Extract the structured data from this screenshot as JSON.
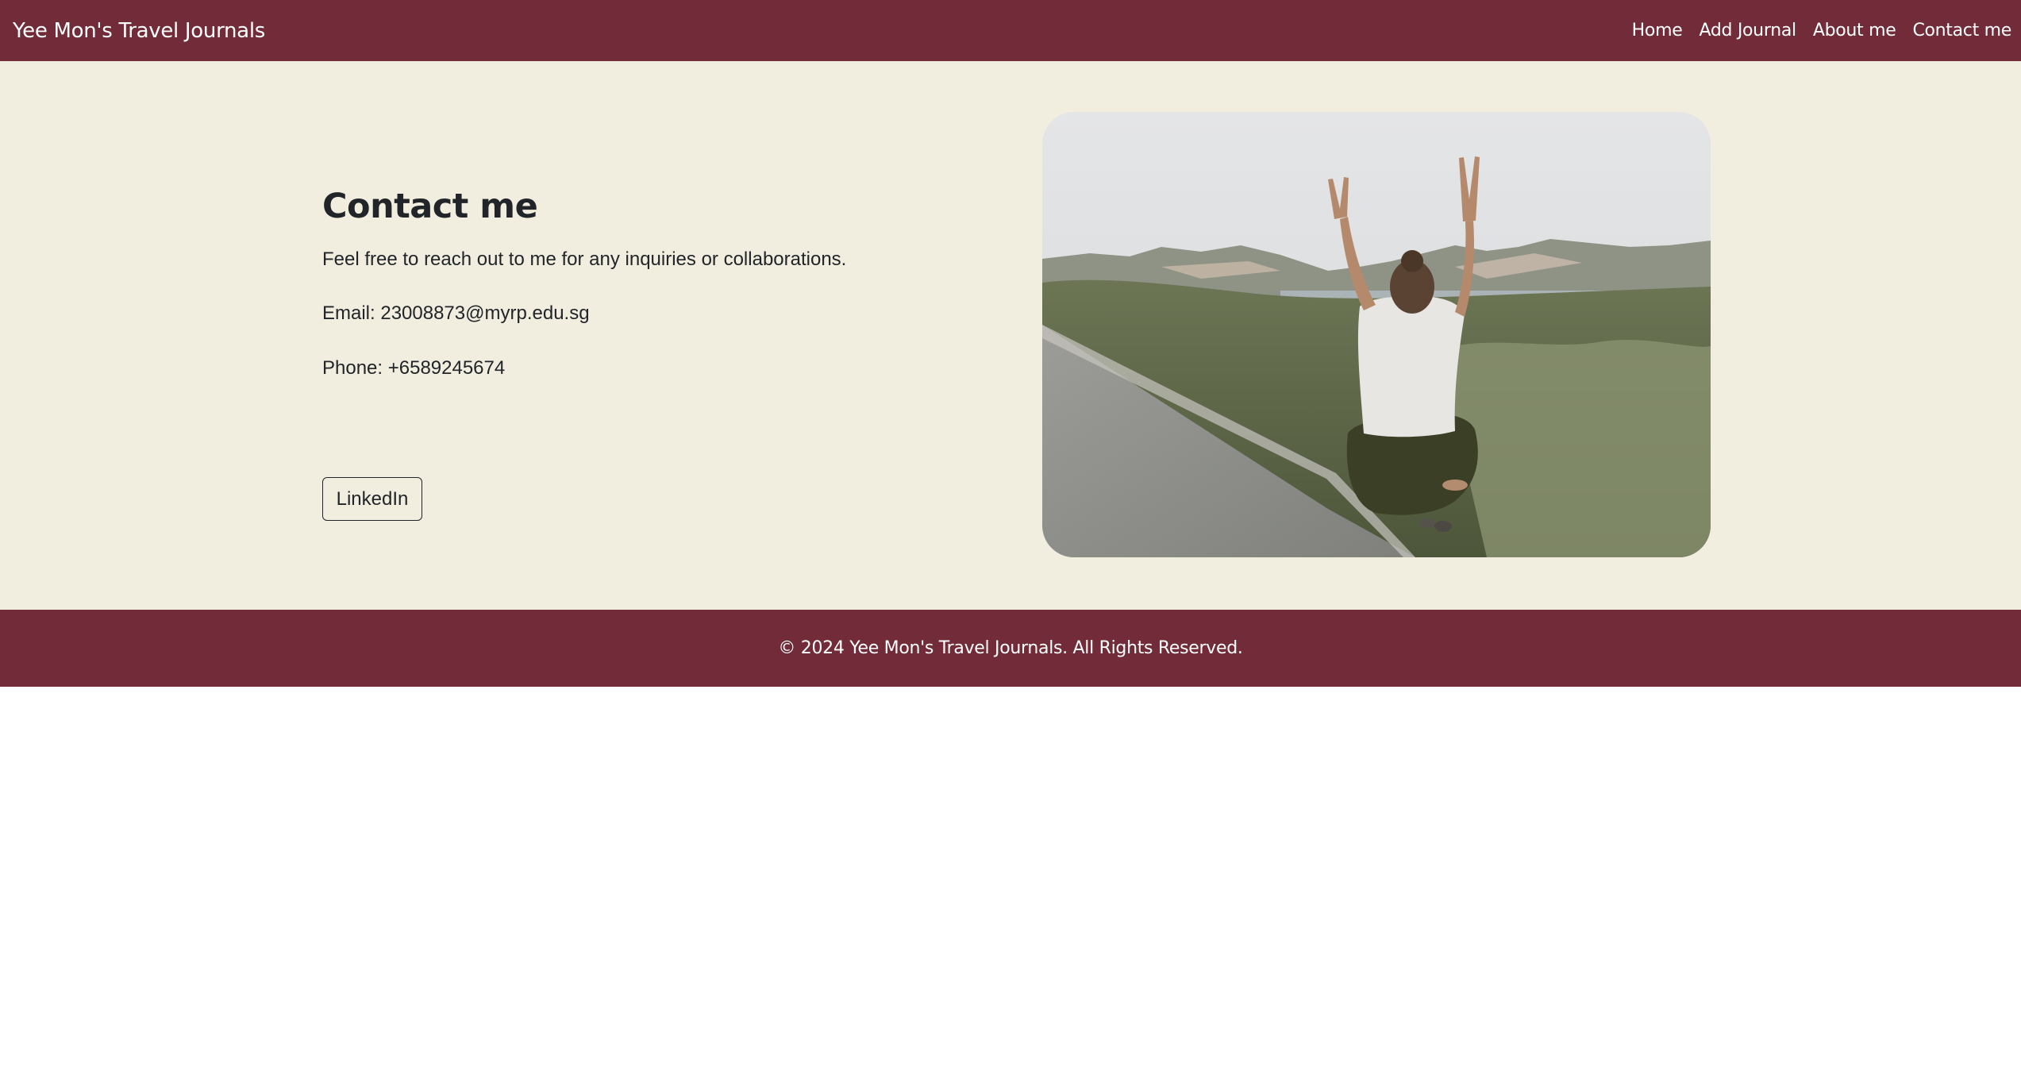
{
  "navbar": {
    "brand": "Yee Mon's Travel Journals",
    "links": [
      {
        "label": "Home"
      },
      {
        "label": "Add Journal"
      },
      {
        "label": "About me"
      },
      {
        "label": "Contact me"
      }
    ]
  },
  "contact": {
    "title": "Contact me",
    "intro": "Feel free to reach out to me for any inquiries or collaborations.",
    "email": "Email: 23008873@myrp.edu.sg",
    "phone": "Phone: +6589245674",
    "linkedin_label": "LinkedIn"
  },
  "footer": {
    "text": "© 2024 Yee Mon's Travel Journals. All Rights Reserved."
  },
  "colors": {
    "brand": "#722c39",
    "background": "#f2eedf",
    "text": "#212529"
  }
}
